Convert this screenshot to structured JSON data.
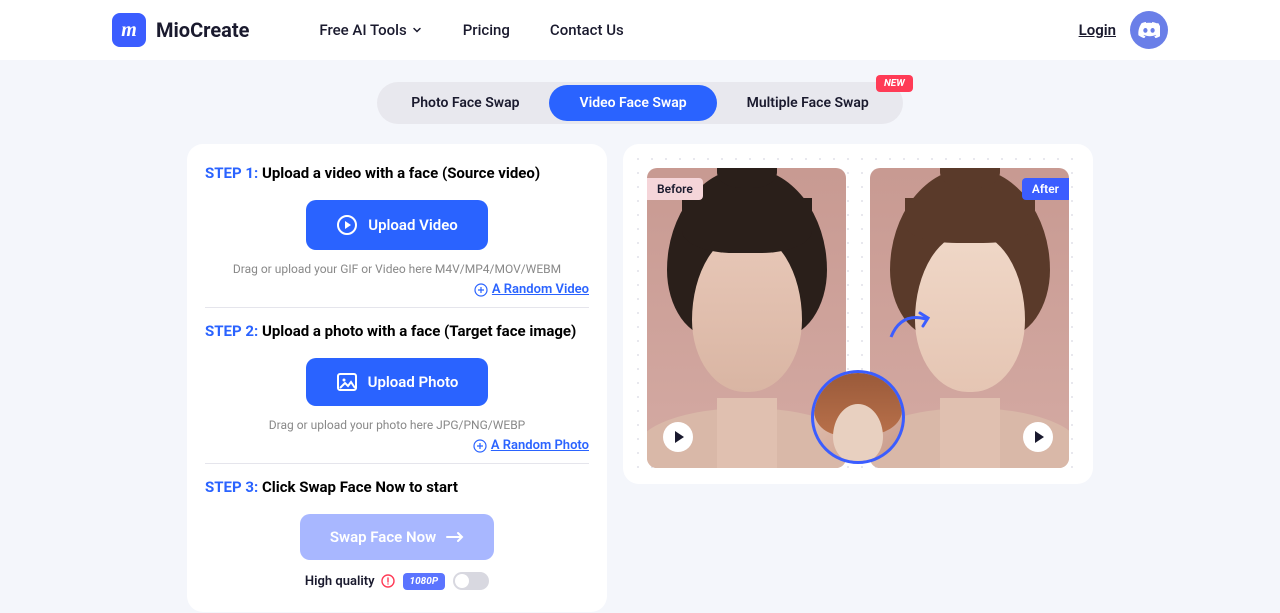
{
  "header": {
    "logo_text": "MioCreate",
    "nav": {
      "free_tools": "Free AI Tools",
      "pricing": "Pricing",
      "contact": "Contact Us"
    },
    "login": "Login"
  },
  "tabs": {
    "photo": "Photo Face Swap",
    "video": "Video Face Swap",
    "multiple": "Multiple Face Swap",
    "new_badge": "NEW"
  },
  "step1": {
    "label": "STEP 1:",
    "title": "Upload a video with a face (Source video)",
    "button": "Upload Video",
    "hint": "Drag or upload your GIF or Video here M4V/MP4/MOV/WEBM",
    "random": "A Random Video"
  },
  "step2": {
    "label": "STEP 2:",
    "title": "Upload a photo with a face (Target face image)",
    "button": "Upload Photo",
    "hint": "Drag or upload your photo here JPG/PNG/WEBP",
    "random": "A Random Photo"
  },
  "step3": {
    "label": "STEP 3:",
    "title": "Click Swap Face Now to start",
    "button": "Swap Face Now"
  },
  "quality": {
    "label": "High quality",
    "badge": "1080P"
  },
  "preview": {
    "before": "Before",
    "after": "After"
  }
}
